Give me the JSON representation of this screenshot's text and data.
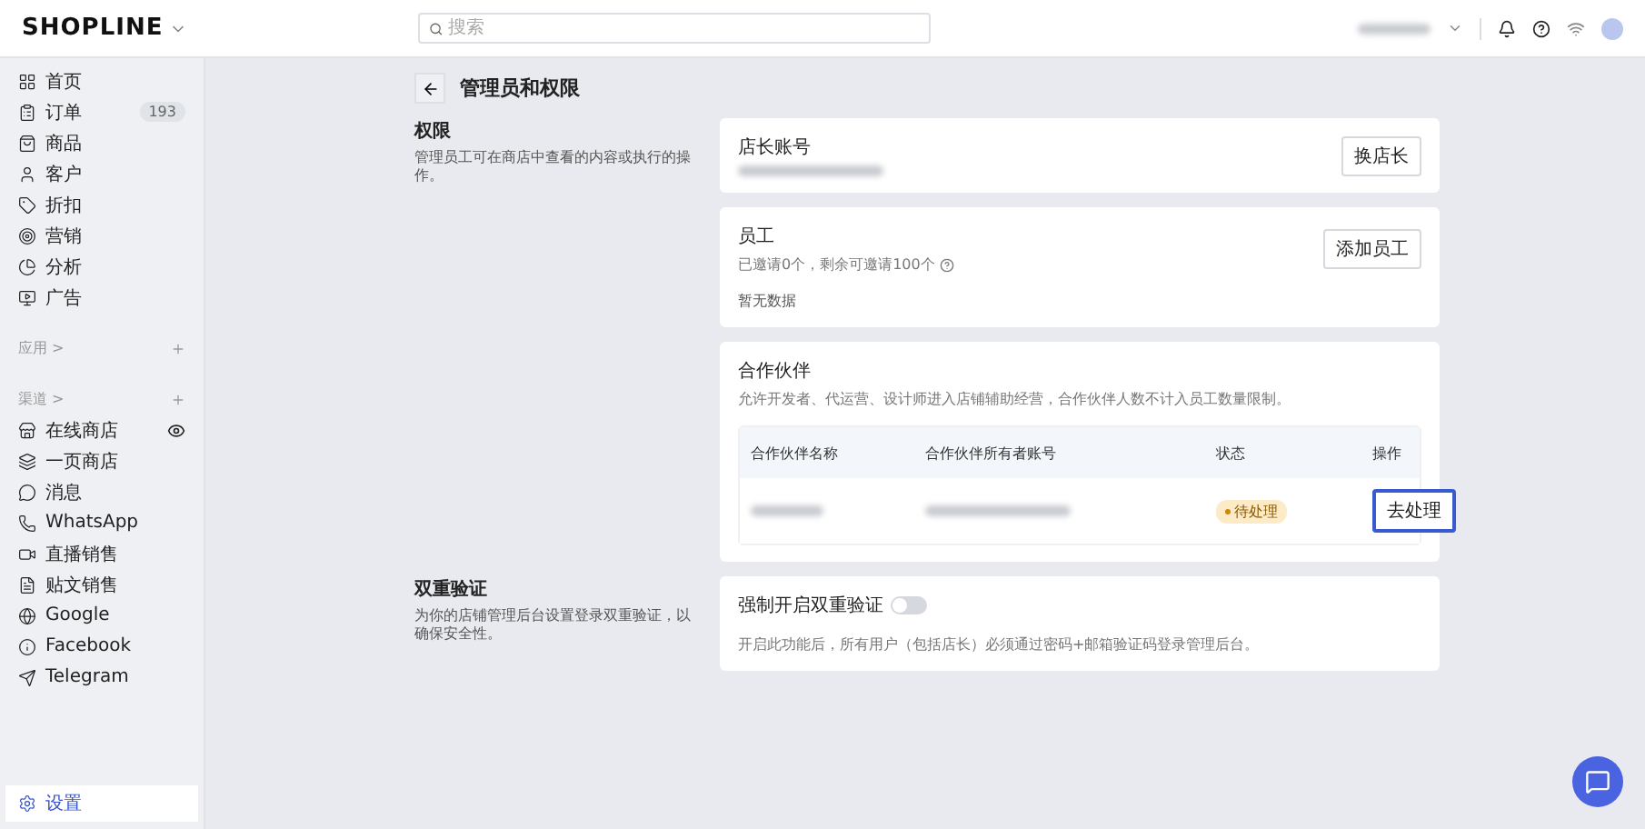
{
  "topbar": {
    "logo": "SHOPLINE",
    "search": {
      "placeholder": "搜索"
    }
  },
  "sidebar": {
    "items": [
      {
        "label": "首页",
        "selected": false
      },
      {
        "label": "订单",
        "badge": "193",
        "selected": false
      },
      {
        "label": "商品",
        "selected": false
      },
      {
        "label": "客户",
        "selected": false
      },
      {
        "label": "折扣",
        "selected": false
      },
      {
        "label": "营销",
        "selected": false
      },
      {
        "label": "分析",
        "selected": false
      },
      {
        "label": "广告",
        "selected": false
      }
    ],
    "sections": [
      {
        "label": "应用 >"
      },
      {
        "label": "渠道 >",
        "items": [
          {
            "label": "在线商店",
            "selected": false
          },
          {
            "label": "一页商店",
            "selected": false
          },
          {
            "label": "消息",
            "selected": false
          },
          {
            "label": "WhatsApp",
            "selected": false
          },
          {
            "label": "直播销售",
            "selected": false
          },
          {
            "label": "贴文销售",
            "selected": false
          },
          {
            "label": "Google",
            "selected": false
          },
          {
            "label": "Facebook",
            "selected": false
          },
          {
            "label": "Telegram",
            "selected": false
          }
        ]
      }
    ],
    "footer": {
      "label": "设置",
      "selected": true
    }
  },
  "page": {
    "title": "管理员和权限",
    "sections": [
      {
        "title": "权限",
        "description": "管理员工可在商店中查看的内容或执行的操作。",
        "cards": [
          {
            "kind": "owner",
            "title": "店长账号",
            "button": "换店长"
          },
          {
            "kind": "staff",
            "title": "员工",
            "subtitle": "已邀请0个，剩余可邀请100个",
            "empty": "暂无数据",
            "button": "添加员工"
          },
          {
            "kind": "partners",
            "title": "合作伙伴",
            "subtitle": "允许开发者、代运营、设计师进入店铺辅助经营，合作伙伴人数不计入员工数量限制。",
            "table": {
              "columns": [
                "合作伙伴名称",
                "合作伙伴所有者账号",
                "状态",
                "操作"
              ],
              "rows": [
                {
                  "status": "待处理",
                  "action": {
                    "label": "去处理",
                    "focused": true
                  }
                }
              ]
            }
          }
        ]
      },
      {
        "title": "双重验证",
        "description": "为你的店铺管理后台设置登录双重验证，以确保安全性。",
        "cards": [
          {
            "kind": "toggle",
            "title": "强制开启双重验证",
            "on": false,
            "note": "开启此功能后，所有用户（包括店长）必须通过密码+邮箱验证码登录管理后台。"
          }
        ]
      }
    ]
  }
}
